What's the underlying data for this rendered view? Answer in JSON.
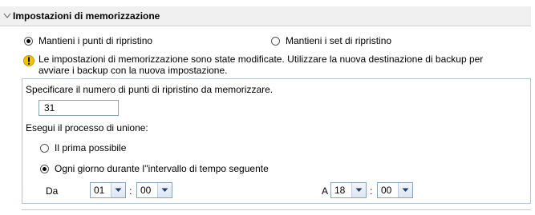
{
  "section": {
    "title": "Impostazioni di memorizzazione"
  },
  "retention_mode": {
    "options": [
      {
        "label": "Mantieni i punti di ripristino",
        "checked": true
      },
      {
        "label": "Mantieni i set di ripristino",
        "checked": false
      }
    ]
  },
  "warning": {
    "icon": "warning-icon",
    "text": "Le impostazioni di memorizzazione sono state modificate. Utilizzare la nuova destinazione di backup per avviare i backup con la nuova impostazione."
  },
  "recovery_points": {
    "label": "Specificare il numero di punti di ripristino da memorizzare.",
    "value": "31"
  },
  "merge": {
    "label": "Esegui il processo di unione:",
    "options": [
      {
        "label": "Il prima possibile",
        "checked": false
      },
      {
        "label": "Ogni giorno durante l''intervallo di tempo seguente",
        "checked": true
      }
    ],
    "from_label": "Da",
    "from_hour": "01",
    "from_minute": "00",
    "to_label": "A",
    "to_hour": "18",
    "to_minute": "00",
    "time_separator": ":"
  },
  "colors": {
    "accent_border": "#b3c5dd",
    "header_bg": "#f0f0f0",
    "warning": "#f0c000"
  }
}
